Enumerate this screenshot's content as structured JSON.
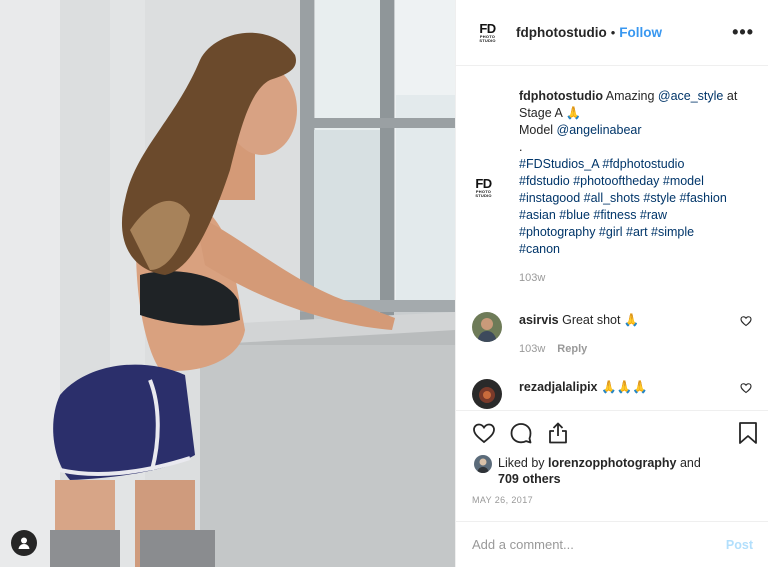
{
  "header": {
    "logo_main": "FD",
    "logo_sub_1": "PHOTO",
    "logo_sub_2": "STUDIO",
    "username": "fdphotostudio",
    "separator": "•",
    "follow_label": "Follow",
    "more_label": "•••"
  },
  "caption": {
    "username": "fdphotostudio",
    "line1_text": " Amazing ",
    "line1_mention": "@ace_style",
    "line1_tail": " at",
    "line2": "Stage A 🙏",
    "line3_text": "Model ",
    "line3_mention": "@angelinabear",
    "line4": ".",
    "hashtags_1": "#FDStudios_A #fdphotostudio",
    "hashtags_2": "#fdstudio #photooftheday #model",
    "hashtags_3": "#instagood #all_shots #style #fashion",
    "hashtags_4": "#asian #blue #fitness #raw",
    "hashtags_5": "#photography #girl #art #simple",
    "hashtags_6": "#canon",
    "time": "103w"
  },
  "comments": [
    {
      "username": "asirvis",
      "text": " Great shot 🙏",
      "time": "103w",
      "reply_label": "Reply"
    },
    {
      "username": "rezadjalalipix",
      "text": " 🙏🙏🙏"
    }
  ],
  "likes": {
    "prefix": "Liked by ",
    "user": "lorenzopphotography",
    "middle": " and",
    "count": "709 others"
  },
  "date": "MAY 26, 2017",
  "add_comment": {
    "placeholder": "Add a comment...",
    "post_label": "Post"
  },
  "icons": {
    "like": "heart-icon",
    "comment": "comment-icon",
    "share": "share-icon",
    "save": "bookmark-icon",
    "tag": "user-tag-icon"
  },
  "colors": {
    "link": "#003569",
    "follow": "#3897f0",
    "muted": "#999999",
    "post_disabled": "#b2dffc"
  }
}
